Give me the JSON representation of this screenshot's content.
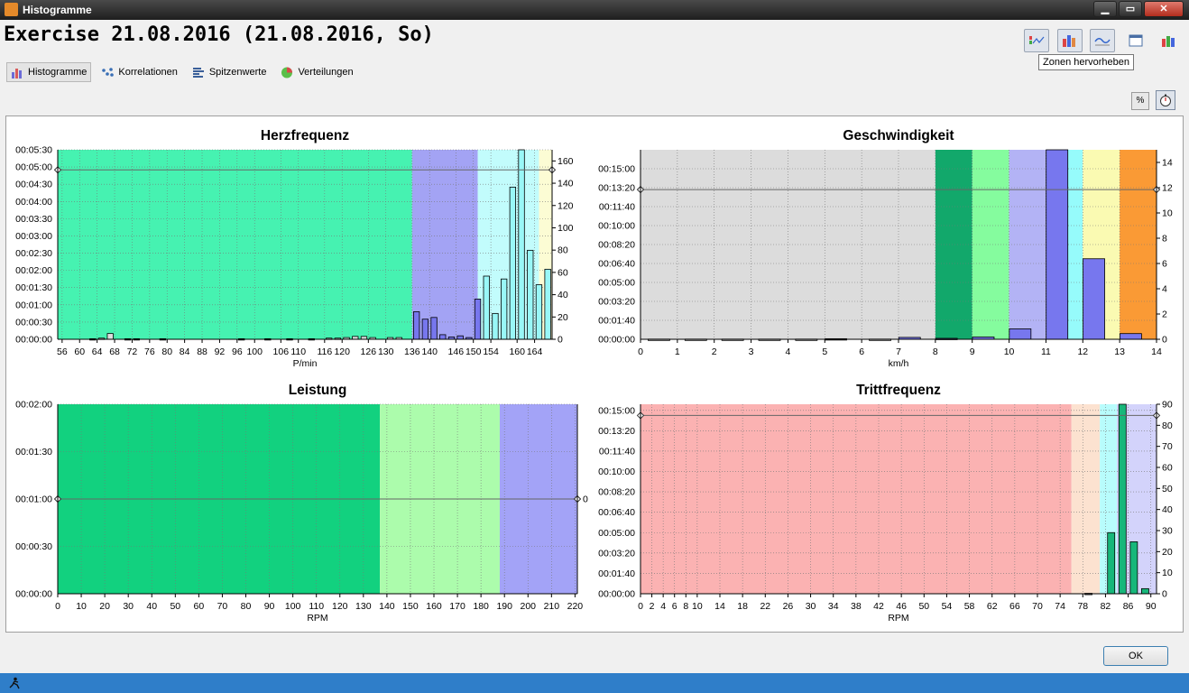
{
  "window": {
    "title": "Histogramme",
    "minimize": "▁",
    "maximize": "▭",
    "close": "✕"
  },
  "heading": "Exercise 21.08.2016 (21.08.2016, So)",
  "tabs": [
    {
      "label": "Histogramme",
      "icon": "bar-chart-icon",
      "active": true
    },
    {
      "label": "Korrelationen",
      "icon": "scatter-icon",
      "active": false
    },
    {
      "label": "Spitzenwerte",
      "icon": "peaks-icon",
      "active": false
    },
    {
      "label": "Verteilungen",
      "icon": "pie-chart-icon",
      "active": false
    }
  ],
  "tooltip": "Zonen hervorheben",
  "toggles": {
    "percent": "%"
  },
  "footer": {
    "ok": "OK"
  },
  "chart_data": [
    {
      "type": "bar",
      "title": "Herzfrequenz",
      "xlabel": "P/min",
      "xlim": [
        55,
        168
      ],
      "xticks": [
        56,
        60,
        64,
        68,
        72,
        76,
        80,
        84,
        88,
        92,
        96,
        100,
        106,
        110,
        116,
        120,
        126,
        130,
        136,
        140,
        146,
        150,
        154,
        160,
        164
      ],
      "ylim_seconds": [
        0,
        330
      ],
      "yticks": [
        "00:00:00",
        "00:00:30",
        "00:01:00",
        "00:01:30",
        "00:02:00",
        "00:02:30",
        "00:03:00",
        "00:03:30",
        "00:04:00",
        "00:04:30",
        "00:05:00",
        "00:05:30"
      ],
      "y2lim": [
        0,
        170
      ],
      "y2ticks": [
        "0",
        "20",
        "40",
        "60",
        "80",
        "100",
        "120",
        "140",
        "160"
      ],
      "zones": [
        {
          "from": 55,
          "to": 136,
          "color": "#46f2b1"
        },
        {
          "from": 136,
          "to": 151,
          "color": "#a3a3f4"
        },
        {
          "from": 151,
          "to": 165,
          "color": "#c2fcfc"
        },
        {
          "from": 165,
          "to": 168,
          "color": "#fcfcd4"
        }
      ],
      "threshold_y": 295,
      "bars": [
        {
          "x": 63,
          "y": 1
        },
        {
          "x": 65,
          "y": 2
        },
        {
          "x": 67,
          "y": 10
        },
        {
          "x": 71,
          "y": 1
        },
        {
          "x": 73,
          "y": 1
        },
        {
          "x": 79,
          "y": 1
        },
        {
          "x": 97,
          "y": 1
        },
        {
          "x": 103,
          "y": 1
        },
        {
          "x": 108,
          "y": 1
        },
        {
          "x": 113,
          "y": 1
        },
        {
          "x": 117,
          "y": 2
        },
        {
          "x": 119,
          "y": 2
        },
        {
          "x": 121,
          "y": 3
        },
        {
          "x": 123,
          "y": 5
        },
        {
          "x": 125,
          "y": 5
        },
        {
          "x": 127,
          "y": 3
        },
        {
          "x": 131,
          "y": 3
        },
        {
          "x": 133,
          "y": 3
        },
        {
          "x": 137,
          "y": 48,
          "color": "#7777ee"
        },
        {
          "x": 139,
          "y": 35,
          "color": "#7777ee"
        },
        {
          "x": 141,
          "y": 38,
          "color": "#7777ee"
        },
        {
          "x": 143,
          "y": 8,
          "color": "#7777ee"
        },
        {
          "x": 145,
          "y": 4,
          "color": "#7777ee"
        },
        {
          "x": 147,
          "y": 6,
          "color": "#7777ee"
        },
        {
          "x": 149,
          "y": 3,
          "color": "#7777ee"
        },
        {
          "x": 151,
          "y": 70,
          "color": "#7777ee"
        },
        {
          "x": 153,
          "y": 110,
          "color": "#99f7f7"
        },
        {
          "x": 155,
          "y": 45,
          "color": "#99f7f7"
        },
        {
          "x": 157,
          "y": 105,
          "color": "#99f7f7"
        },
        {
          "x": 159,
          "y": 265,
          "color": "#99f7f7"
        },
        {
          "x": 161,
          "y": 330,
          "color": "#99f7f7"
        },
        {
          "x": 163,
          "y": 155,
          "color": "#99f7f7"
        },
        {
          "x": 165,
          "y": 95,
          "color": "#99f7f7"
        },
        {
          "x": 167,
          "y": 122,
          "color": "#99f7f7"
        }
      ]
    },
    {
      "type": "bar",
      "title": "Geschwindigkeit",
      "xlabel": "km/h",
      "xlim": [
        0,
        14
      ],
      "xticks": [
        "0",
        "1",
        "2",
        "3",
        "4",
        "5",
        "6",
        "7",
        "8",
        "9",
        "10",
        "11",
        "12",
        "13",
        "14"
      ],
      "ylim_seconds": [
        0,
        1000
      ],
      "yticks": [
        "00:00:00",
        "00:01:40",
        "00:03:20",
        "00:05:00",
        "00:06:40",
        "00:08:20",
        "00:10:00",
        "00:11:40",
        "00:13:20",
        "00:15:00"
      ],
      "y2lim": [
        0,
        15
      ],
      "y2ticks": [
        "0",
        "2",
        "4",
        "6",
        "8",
        "10",
        "12",
        "14"
      ],
      "zones": [
        {
          "from": 0,
          "to": 8,
          "color": "#dcdcdc"
        },
        {
          "from": 8,
          "to": 9,
          "color": "#12a86b"
        },
        {
          "from": 9,
          "to": 10,
          "color": "#85fc9e"
        },
        {
          "from": 10,
          "to": 11,
          "color": "#b3b3f5"
        },
        {
          "from": 11,
          "to": 12,
          "color": "#96fbfb"
        },
        {
          "from": 12,
          "to": 13,
          "color": "#fafab2"
        },
        {
          "from": 13,
          "to": 14,
          "color": "#fa9a35"
        }
      ],
      "threshold_y": 790,
      "bars": [
        {
          "x": 0.5,
          "y": 1
        },
        {
          "x": 1.5,
          "y": 1
        },
        {
          "x": 2.5,
          "y": 1
        },
        {
          "x": 3.5,
          "y": 1
        },
        {
          "x": 4.5,
          "y": 1
        },
        {
          "x": 5.3,
          "y": 3
        },
        {
          "x": 6.5,
          "y": 1
        },
        {
          "x": 7.3,
          "y": 10,
          "color": "#7777ee"
        },
        {
          "x": 8.3,
          "y": 5,
          "color": "#7777ee"
        },
        {
          "x": 9.3,
          "y": 12,
          "color": "#7777ee"
        },
        {
          "x": 10.3,
          "y": 55,
          "color": "#7777ee"
        },
        {
          "x": 11.3,
          "y": 1000,
          "color": "#7777ee"
        },
        {
          "x": 12.3,
          "y": 425,
          "color": "#7777ee"
        },
        {
          "x": 13.3,
          "y": 30,
          "color": "#7777ee"
        }
      ]
    },
    {
      "type": "bar",
      "title": "Leistung",
      "xlabel": "RPM",
      "xlim": [
        0,
        221
      ],
      "xticks": [
        "0",
        "10",
        "20",
        "30",
        "40",
        "50",
        "60",
        "70",
        "80",
        "90",
        "100",
        "110",
        "120",
        "130",
        "140",
        "150",
        "160",
        "170",
        "180",
        "190",
        "200",
        "210",
        "220"
      ],
      "ylim_seconds": [
        0,
        120
      ],
      "yticks": [
        "00:00:00",
        "00:00:30",
        "00:01:00",
        "00:01:30",
        "00:02:00"
      ],
      "y2lim": [
        -1,
        1
      ],
      "y2ticks": [
        "0"
      ],
      "zones": [
        {
          "from": 0,
          "to": 137,
          "color": "#12d17f"
        },
        {
          "from": 137,
          "to": 188,
          "color": "#acfcac"
        },
        {
          "from": 188,
          "to": 221,
          "color": "#a3a3f7"
        }
      ],
      "threshold_y": 60,
      "bars": []
    },
    {
      "type": "bar",
      "title": "Trittfrequenz",
      "xlabel": "RPM",
      "xlim": [
        0,
        91
      ],
      "xticks": [
        "0",
        "2",
        "4",
        "6",
        "8",
        "10",
        "14",
        "18",
        "22",
        "26",
        "30",
        "34",
        "38",
        "42",
        "46",
        "50",
        "54",
        "58",
        "62",
        "66",
        "70",
        "74",
        "78",
        "82",
        "86",
        "90"
      ],
      "ylim_seconds": [
        0,
        930
      ],
      "yticks": [
        "00:00:00",
        "00:01:40",
        "00:03:20",
        "00:05:00",
        "00:06:40",
        "00:08:20",
        "00:10:00",
        "00:11:40",
        "00:13:20",
        "00:15:00"
      ],
      "y2lim": [
        0,
        90
      ],
      "y2ticks": [
        "0",
        "10",
        "20",
        "30",
        "40",
        "50",
        "60",
        "70",
        "80",
        "90"
      ],
      "zones": [
        {
          "from": 0,
          "to": 76,
          "color": "#fbb2b2"
        },
        {
          "from": 76,
          "to": 81,
          "color": "#fce2d0"
        },
        {
          "from": 81,
          "to": 84,
          "color": "#b8fcfc"
        },
        {
          "from": 84,
          "to": 91,
          "color": "#d3d3fb"
        }
      ],
      "threshold_y": 875,
      "bars": [
        {
          "x": 79,
          "y": 2
        },
        {
          "x": 83,
          "y": 300,
          "color": "#17b77a"
        },
        {
          "x": 85,
          "y": 930,
          "color": "#17b77a"
        },
        {
          "x": 87,
          "y": 255,
          "color": "#17b77a"
        },
        {
          "x": 89,
          "y": 25,
          "color": "#17b77a"
        }
      ]
    }
  ]
}
